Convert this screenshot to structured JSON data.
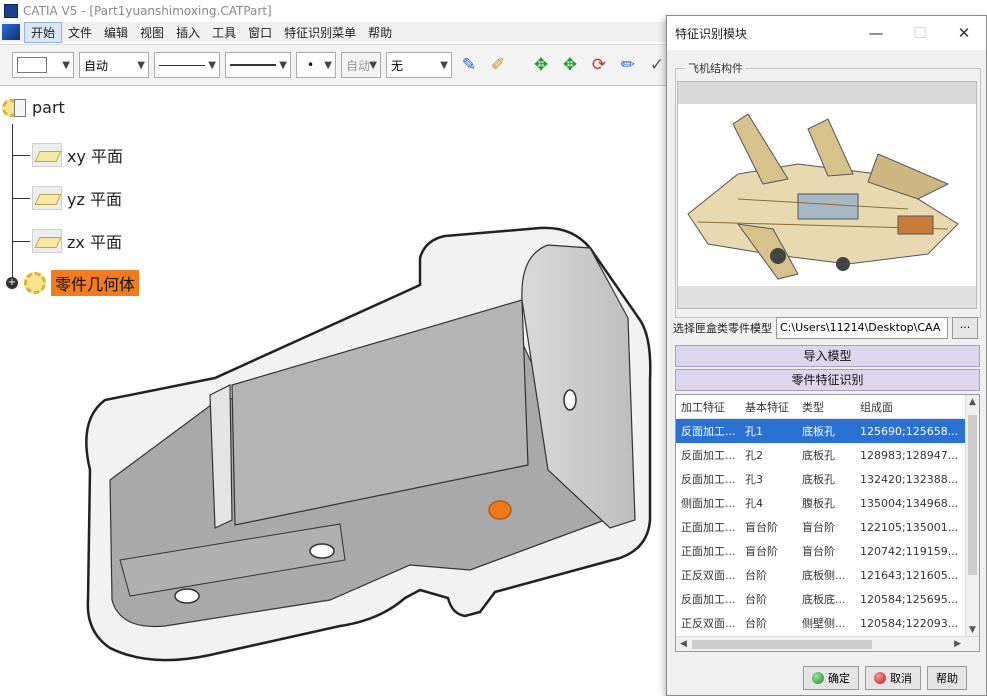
{
  "window": {
    "title": "CATIA V5 - [Part1yuanshimoxing.CATPart]"
  },
  "menu": [
    "开始",
    "文件",
    "编辑",
    "视图",
    "插入",
    "工具",
    "窗口",
    "特征识别菜单",
    "帮助"
  ],
  "toolbar": {
    "color_select": "",
    "auto_select": "自动",
    "layer_select": "自动",
    "none_select": "无"
  },
  "tree": {
    "root": "part",
    "planes": [
      "xy 平面",
      "yz 平面",
      "zx 平面"
    ],
    "body": "零件几何体"
  },
  "dialog": {
    "title": "特征识别模块",
    "group_label": "飞机结构件",
    "path_label": "选择匣盒类零件模型",
    "path_value": "C:\\Users\\11214\\Desktop\\CAA",
    "browse_label": "...",
    "import_button": "导入模型",
    "recognize_button": "零件特征识别",
    "columns": [
      "加工特征",
      "基本特征",
      "类型",
      "组成面"
    ],
    "rows": [
      [
        "反面加工...",
        "孔1",
        "底板孔",
        "125690;125658..."
      ],
      [
        "反面加工...",
        "孔2",
        "底板孔",
        "128983;128947..."
      ],
      [
        "反面加工...",
        "孔3",
        "底板孔",
        "132420;132388..."
      ],
      [
        "侧面加工...",
        "孔4",
        "腹板孔",
        "135004;134968..."
      ],
      [
        "正面加工...",
        "盲台阶",
        "盲台阶",
        "122105;135001..."
      ],
      [
        "正面加工...",
        "盲台阶",
        "盲台阶",
        "120742;119159..."
      ],
      [
        "正反双面...",
        "台阶",
        "底板侧...",
        "121643;121605..."
      ],
      [
        "反面加工...",
        "台阶",
        "底板底...",
        "120584;125695..."
      ],
      [
        "正反双面...",
        "台阶",
        "侧壁侧...",
        "120584;122093..."
      ]
    ],
    "ok_button": "确定",
    "cancel_button": "取消",
    "help_button": "帮助"
  }
}
